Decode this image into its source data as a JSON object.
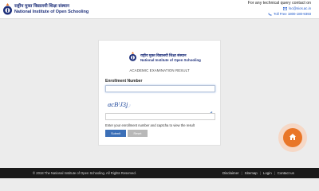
{
  "header": {
    "logo_hindi": "राष्ट्रीय मुक्त विद्यालयी शिक्षा संस्थान",
    "logo_english": "National Institute of Open Schooling",
    "contact_title": "For any technical query contact on",
    "email": "lsc@nios.ac.in",
    "tollfree": "Toll Free 1800-180-9393"
  },
  "card": {
    "logo_hindi": "राष्ट्रीय मुक्त विद्यालयी शिक्षा संस्थान",
    "logo_english": "National Institute of Open Schooling",
    "heading": "ACADEMIC EXAMINATION RESULT",
    "enrollment_label": "Enrollment Number",
    "enrollment_value": "",
    "captcha_text": "acB'J3j",
    "captcha_value": "",
    "hint": "Enter your enrollment number and captcha to view the result",
    "submit_label": "Submit",
    "reset_label": "Reset"
  },
  "footer": {
    "copyright": "© 2018 The National Institute of Open Schooling. All Rights Reserved.",
    "links": [
      "Disclaimer",
      "Sitemap",
      "Login",
      "Contact us"
    ]
  },
  "colors": {
    "accent_blue": "#3b6fb7",
    "home_orange": "#e97628",
    "footer_bg": "#1a1a1a",
    "logo_navy": "#1d2f7a"
  },
  "icons": {
    "logo": "nios-logo-icon",
    "email": "email-icon",
    "phone": "phone-icon",
    "refresh": "refresh-icon",
    "home": "home-icon"
  }
}
